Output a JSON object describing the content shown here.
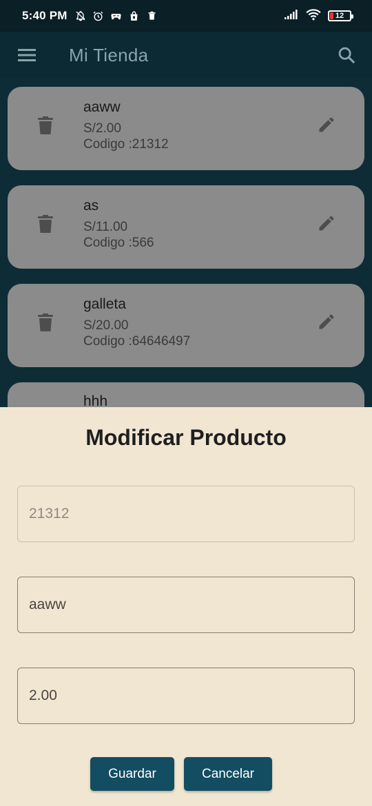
{
  "status_bar": {
    "time": "5:40 PM",
    "battery": "12"
  },
  "app_bar": {
    "title": "Mi Tienda"
  },
  "products": [
    {
      "name": "aaww",
      "price": "S/2.00",
      "code": "Codigo :21312"
    },
    {
      "name": "as",
      "price": "S/11.00",
      "code": "Codigo :566"
    },
    {
      "name": "galleta",
      "price": "S/20.00",
      "code": "Codigo :64646497"
    },
    {
      "name": "hhh",
      "price": "",
      "code": ""
    }
  ],
  "dialog": {
    "title": "Modificar Producto",
    "code_value": "21312",
    "name_value": "aaww",
    "price_value": "2.00",
    "save_label": "Guardar",
    "cancel_label": "Cancelar"
  },
  "colors": {
    "app_bar": "#0c2a34",
    "card": "#8b8b8b",
    "sheet": "#f1e6d2",
    "button": "#134d61",
    "battery_low": "#e53935"
  }
}
